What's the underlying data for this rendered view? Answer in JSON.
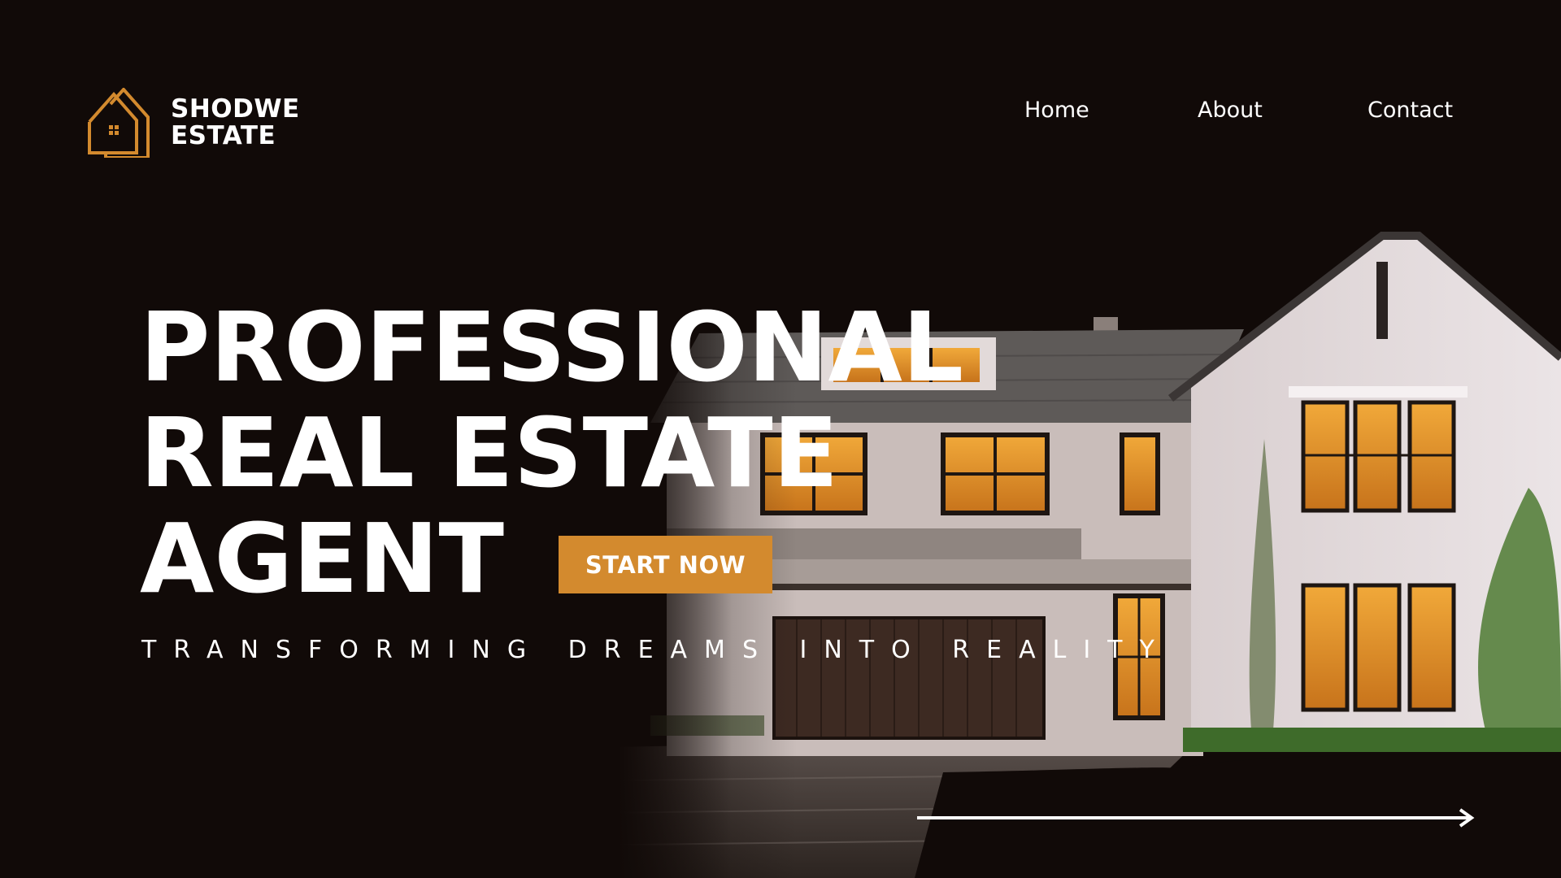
{
  "brand": {
    "line1": "SHODWE",
    "line2": "ESTATE",
    "icon": "house-logo-icon",
    "accent_color": "#d38a2e"
  },
  "nav": {
    "items": [
      "Home",
      "About",
      "Contact"
    ]
  },
  "hero": {
    "headline": [
      "PROFESSIONAL",
      "REAL ESTATE",
      "AGENT"
    ],
    "cta_label": "START NOW",
    "tagline": "TRANSFORMING DREAMS INTO REALITY",
    "arrow_icon": "arrow-right-icon"
  },
  "colors": {
    "background": "#110a08",
    "text": "#ffffff",
    "accent": "#d38a2e"
  }
}
